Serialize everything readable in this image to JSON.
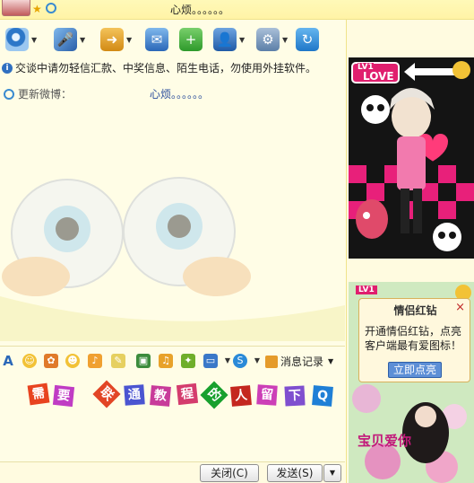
{
  "window": {
    "signature": "心烦。。。。。。"
  },
  "notice": {
    "text": "交谈中请勿轻信汇款、中奖信息、陌生电话，勿使用外挂软件。"
  },
  "weibo": {
    "label": "更新微博：",
    "message": "心烦。。。。。。"
  },
  "toolbar": {
    "icons": [
      "video-call-icon",
      "voice-call-icon",
      "send-file-icon",
      "share-screen-icon",
      "add-app-icon",
      "profile-icon",
      "settings-icon",
      "refresh-icon"
    ]
  },
  "input_toolbar": {
    "history_label": "消息记录"
  },
  "input": {
    "tiles": [
      {
        "char": "需",
        "color": "#e8431f"
      },
      {
        "char": "要",
        "color": "#c03cc4"
      },
      {
        "char": "联",
        "color": "#e24525"
      },
      {
        "char": "通",
        "color": "#4b55d1"
      },
      {
        "char": "教",
        "color": "#c83b9a"
      },
      {
        "char": "程",
        "color": "#d43c6d"
      },
      {
        "char": "的",
        "color": "#18a02e"
      },
      {
        "char": "人",
        "color": "#c4271f"
      },
      {
        "char": "留",
        "color": "#cc3fb7"
      },
      {
        "char": "下",
        "color": "#7f4fcf"
      },
      {
        "char": "Q",
        "color": "#1f7fd6"
      }
    ]
  },
  "buttons": {
    "close": "关闭(C)",
    "send": "发送(S)"
  },
  "show_panel": {
    "badge": "LV1",
    "love": "LOVE"
  },
  "promo": {
    "badge": "LV1",
    "title": "情侣红钻",
    "text": "开通情侣红钻，点亮客户端最有爱图标！",
    "button": "立即点亮",
    "close": "×",
    "footer": "宝贝爱你"
  },
  "colors": {
    "brand_yellow": "#fff3a6",
    "link_blue": "#2a4d9c",
    "promo_button": "#5d8fd6"
  }
}
